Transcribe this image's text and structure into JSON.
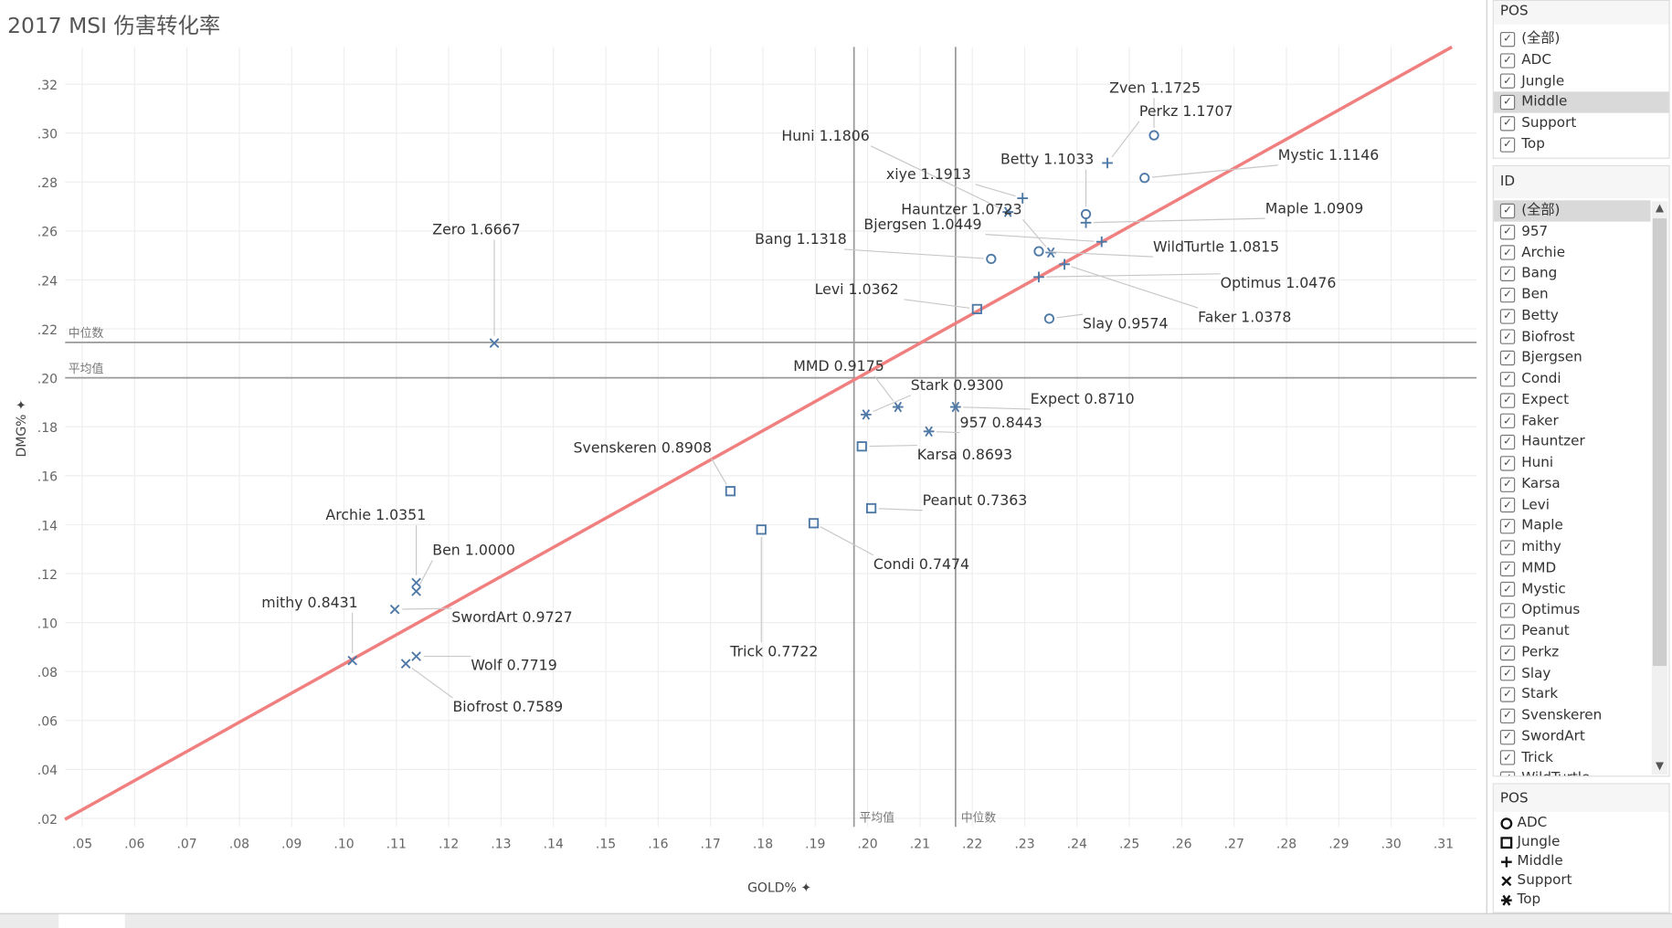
{
  "title": "2017 MSI 伤害转化率",
  "colors": {
    "marker": "#4e79a7",
    "trend": "#f08080",
    "reference": "#999999",
    "grid": "#eeeeee"
  },
  "chart_data": {
    "type": "scatter",
    "title": "2017 MSI 伤害转化率",
    "xlabel": "GOLD%",
    "ylabel": "DMG%",
    "xlim": [
      0.047,
      0.317
    ],
    "ylim": [
      0.017,
      0.335
    ],
    "x_ticks": [
      ".05",
      ".06",
      ".07",
      ".08",
      ".09",
      ".10",
      ".11",
      ".12",
      ".13",
      ".14",
      ".15",
      ".16",
      ".17",
      ".18",
      ".19",
      ".20",
      ".21",
      ".22",
      ".23",
      ".24",
      ".25",
      ".26",
      ".27",
      ".28",
      ".29",
      ".30",
      ".31"
    ],
    "y_ticks": [
      ".02",
      ".04",
      ".06",
      ".08",
      ".10",
      ".12",
      ".14",
      ".16",
      ".18",
      ".20",
      ".22",
      ".24",
      ".26",
      ".28",
      ".30",
      ".32"
    ],
    "grid": true,
    "reference_lines": {
      "y_median": {
        "value": 0.2145,
        "label": "中位数"
      },
      "y_mean": {
        "value": 0.2,
        "label": "平均值"
      },
      "x_mean": {
        "value": 0.1974,
        "label": "平均值"
      },
      "x_median": {
        "value": 0.2168,
        "label": "中位数"
      }
    },
    "trend_line": {
      "x": [
        0.0467,
        0.3116
      ],
      "y": [
        0.0196,
        0.3352
      ]
    },
    "shape_legend": {
      "ADC": "circle",
      "Jungle": "square",
      "Middle": "plus",
      "Support": "cross",
      "Top": "asterisk"
    },
    "points": [
      {
        "label": "Zven 1.1725",
        "pos": "ADC",
        "x": 0.2547,
        "y": 0.2991
      },
      {
        "label": "Perkz 1.1707",
        "pos": "Middle",
        "x": 0.2458,
        "y": 0.2878
      },
      {
        "label": "Huni 1.1806",
        "pos": "Top",
        "x": 0.2268,
        "y": 0.2678
      },
      {
        "label": "xiye 1.1913",
        "pos": "Middle",
        "x": 0.2296,
        "y": 0.2734
      },
      {
        "label": "Betty 1.1033",
        "pos": "ADC",
        "x": 0.2417,
        "y": 0.2669
      },
      {
        "label": "Mystic 1.1146",
        "pos": "ADC",
        "x": 0.2529,
        "y": 0.2817
      },
      {
        "label": "Hauntzer 1.0723",
        "pos": "Top",
        "x": 0.235,
        "y": 0.2512
      },
      {
        "label": "Maple 1.0909",
        "pos": "Middle",
        "x": 0.2417,
        "y": 0.2634
      },
      {
        "label": "Bjergsen 1.0449",
        "pos": "Middle",
        "x": 0.2447,
        "y": 0.2556
      },
      {
        "label": "Bang 1.1318",
        "pos": "ADC",
        "x": 0.2236,
        "y": 0.2486
      },
      {
        "label": "WildTurtle 1.0815",
        "pos": "ADC",
        "x": 0.2327,
        "y": 0.2517
      },
      {
        "label": "Optimus 1.0476",
        "pos": "Middle",
        "x": 0.2327,
        "y": 0.2412
      },
      {
        "label": "Levi 1.0362",
        "pos": "Jungle",
        "x": 0.2209,
        "y": 0.2281
      },
      {
        "label": "Faker 1.0378",
        "pos": "Middle",
        "x": 0.2376,
        "y": 0.2464
      },
      {
        "label": "Slay 0.9574",
        "pos": "ADC",
        "x": 0.2347,
        "y": 0.2242
      },
      {
        "label": "MMD 0.9175",
        "pos": "Top",
        "x": 0.2058,
        "y": 0.1881
      },
      {
        "label": "Stark 0.9300",
        "pos": "Top",
        "x": 0.1997,
        "y": 0.185
      },
      {
        "label": "Expect 0.8710",
        "pos": "Top",
        "x": 0.2168,
        "y": 0.1881
      },
      {
        "label": "957  0.8443",
        "pos": "Top",
        "x": 0.2117,
        "y": 0.1781
      },
      {
        "label": "Karsa 0.8693",
        "pos": "Jungle",
        "x": 0.1989,
        "y": 0.172
      },
      {
        "label": "Svenskeren 0.8908",
        "pos": "Jungle",
        "x": 0.1738,
        "y": 0.1537
      },
      {
        "label": "Peanut 0.7363",
        "pos": "Jungle",
        "x": 0.2007,
        "y": 0.1467
      },
      {
        "label": "Condi 0.7474",
        "pos": "Jungle",
        "x": 0.1897,
        "y": 0.1406
      },
      {
        "label": "Trick 0.7722",
        "pos": "Jungle",
        "x": 0.1797,
        "y": 0.138
      },
      {
        "label": "Archie 1.0351",
        "pos": "Support",
        "x": 0.1138,
        "y": 0.1163
      },
      {
        "label": "Ben 1.0000",
        "pos": "Support",
        "x": 0.1138,
        "y": 0.1128
      },
      {
        "label": "mithy 0.8431",
        "pos": "Support",
        "x": 0.1016,
        "y": 0.0845
      },
      {
        "label": "SwordArt 0.9727",
        "pos": "Support",
        "x": 0.1097,
        "y": 0.1054
      },
      {
        "label": "Wolf 0.7719",
        "pos": "Support",
        "x": 0.1138,
        "y": 0.0862
      },
      {
        "label": "Biofrost 0.7589",
        "pos": "Support",
        "x": 0.1118,
        "y": 0.0832
      },
      {
        "label": "Zero 1.6667",
        "pos": "Support",
        "x": 0.1287,
        "y": 0.2142
      }
    ]
  },
  "pos_filter": {
    "title": "POS",
    "items": [
      {
        "label": "(全部)",
        "checked": true
      },
      {
        "label": "ADC",
        "checked": true
      },
      {
        "label": "Jungle",
        "checked": true
      },
      {
        "label": "Middle",
        "checked": true,
        "highlighted": true
      },
      {
        "label": "Support",
        "checked": true
      },
      {
        "label": "Top",
        "checked": true
      }
    ]
  },
  "id_filter": {
    "title": "ID",
    "items": [
      "(全部)",
      "957",
      "Archie",
      "Bang",
      "Ben",
      "Betty",
      "Biofrost",
      "Bjergsen",
      "Condi",
      "Expect",
      "Faker",
      "Hauntzer",
      "Huni",
      "Karsa",
      "Levi",
      "Maple",
      "mithy",
      "MMD",
      "Mystic",
      "Optimus",
      "Peanut",
      "Perkz",
      "Slay",
      "Stark",
      "Svenskeren",
      "SwordArt",
      "Trick",
      "WildTurtle"
    ]
  },
  "shape_legend": {
    "title": "POS",
    "items": [
      {
        "label": "ADC",
        "shape": "circle"
      },
      {
        "label": "Jungle",
        "shape": "square"
      },
      {
        "label": "Middle",
        "shape": "plus"
      },
      {
        "label": "Support",
        "shape": "cross"
      },
      {
        "label": "Top",
        "shape": "asterisk"
      }
    ]
  }
}
